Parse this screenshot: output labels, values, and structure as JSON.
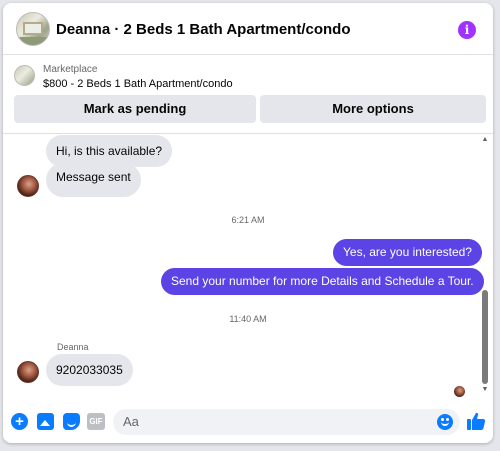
{
  "header": {
    "title": "Deanna · 2 Beds 1 Bath Apartment/condo",
    "info_icon": "info-icon",
    "accent": "#a033ff"
  },
  "marketplace": {
    "label": "Marketplace",
    "listing": "$800 - 2 Beds 1 Bath Apartment/condo",
    "buttons": {
      "pending": "Mark as pending",
      "more": "More options"
    }
  },
  "thread": {
    "messages_top": [
      {
        "from": "Deanna",
        "text": "Hi, is this available?"
      },
      {
        "from": "Deanna",
        "text": "Message sent"
      }
    ],
    "timestamp_1": "6:21 AM",
    "messages_mid": [
      {
        "from": "me",
        "text": "Yes, are you interested?"
      },
      {
        "from": "me",
        "text": "Send your number for more Details and Schedule a Tour."
      }
    ],
    "timestamp_2": "11:40 AM",
    "sender_name": "Deanna",
    "messages_bottom": [
      {
        "from": "Deanna",
        "text": "9202033035"
      }
    ],
    "outgoing_color": "#5b43e6",
    "incoming_color": "#e4e6eb"
  },
  "composer": {
    "placeholder": "Aa",
    "icons": [
      "plus-icon",
      "photo-icon",
      "sticker-icon",
      "gif-icon",
      "emoji-icon",
      "like-icon"
    ],
    "gif_label": "GIF",
    "accent": "#0a7cff"
  }
}
